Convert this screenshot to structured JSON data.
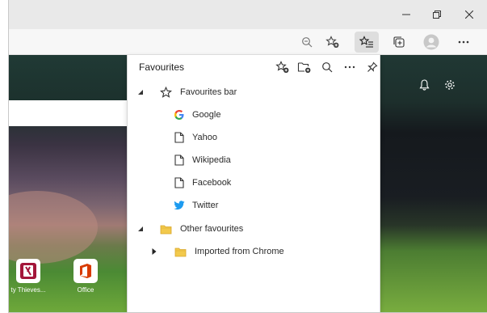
{
  "favourites_panel": {
    "title": "Favourites",
    "items": [
      {
        "label": "Favourites bar",
        "icon": "star-outline-icon",
        "expanded": true
      },
      {
        "label": "Google",
        "icon": "google-icon"
      },
      {
        "label": "Yahoo",
        "icon": "page-icon"
      },
      {
        "label": "Wikipedia",
        "icon": "page-icon"
      },
      {
        "label": "Facebook",
        "icon": "page-icon"
      },
      {
        "label": "Twitter",
        "icon": "twitter-icon"
      },
      {
        "label": "Other favourites",
        "icon": "folder-icon",
        "expanded": true
      },
      {
        "label": "Imported from Chrome",
        "icon": "folder-icon",
        "expanded": false
      }
    ]
  },
  "new_tab_page": {
    "tiles": [
      {
        "label": "ty Thieves...",
        "icon": "sea-of-thieves-icon"
      },
      {
        "label": "Office",
        "icon": "office-icon"
      }
    ]
  },
  "colors": {
    "folder": "#f2c94c",
    "google_blue": "#4285f4",
    "twitter": "#1d9bf0",
    "office": "#d83b01"
  }
}
